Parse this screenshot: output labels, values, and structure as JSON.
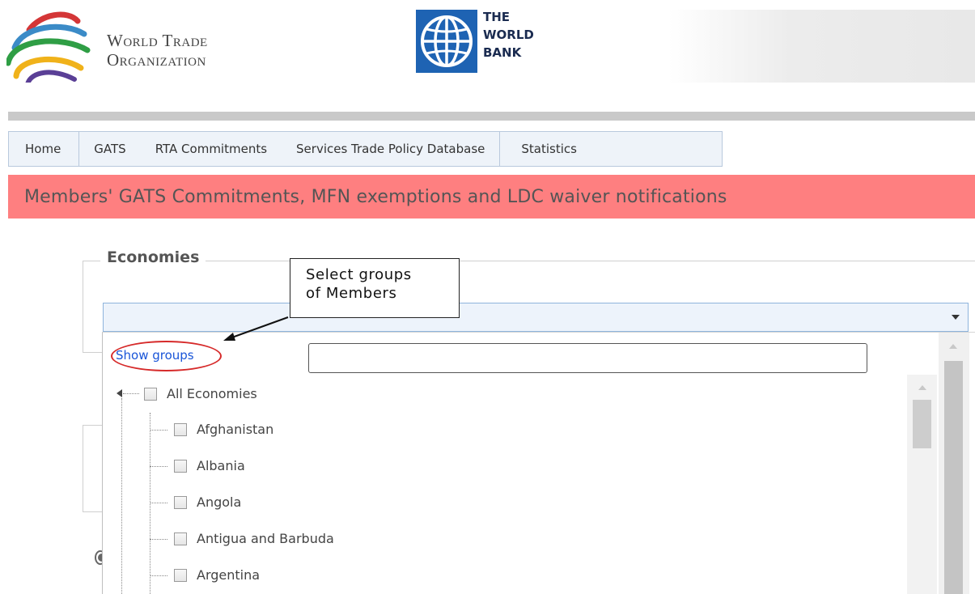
{
  "header": {
    "wto": {
      "line1": "World Trade",
      "line2": "Organization"
    },
    "worldbank": {
      "line1": "THE",
      "line2": "WORLD",
      "line3": "BANK"
    }
  },
  "nav": {
    "items": [
      {
        "label": "Home"
      },
      {
        "label": "GATS"
      },
      {
        "label": "RTA Commitments"
      },
      {
        "label": "Services Trade Policy Database"
      },
      {
        "label": "Statistics"
      }
    ]
  },
  "title_bar": {
    "text": "Members' GATS Commitments, MFN exemptions and LDC waiver notifications",
    "background": "#fe7f80"
  },
  "economies": {
    "legend": "Economies",
    "selected_value": "",
    "dropdown": {
      "show_groups_link": "Show groups",
      "search_value": "",
      "tree": {
        "root": "All Economies",
        "children": [
          "Afghanistan",
          "Albania",
          "Angola",
          "Antigua and Barbuda",
          "Argentina"
        ]
      }
    }
  },
  "annotation": {
    "callout_line1": "Select groups",
    "callout_line2": "of Members",
    "highlight_color": "#d62a2a"
  },
  "icons": {
    "wto": "wto-logo-icon",
    "worldbank": "worldbank-globe-icon",
    "dropdown": "chevron-down-icon",
    "expander": "tree-expand-icon"
  }
}
